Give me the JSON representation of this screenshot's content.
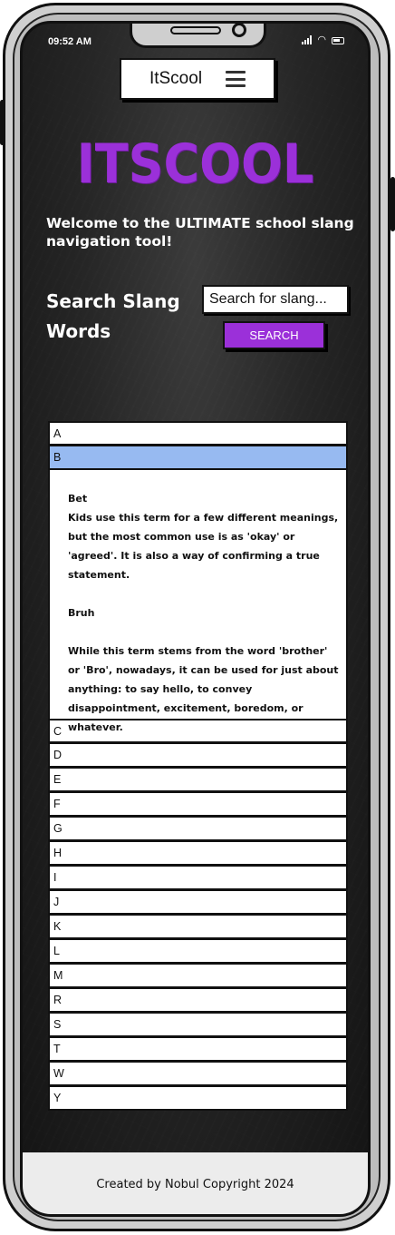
{
  "status": {
    "time": "09:52 AM",
    "icons": [
      "signal-icon",
      "wifi-icon",
      "battery-icon"
    ]
  },
  "nav": {
    "title": "ItScool",
    "menu_icon": "hamburger-menu-icon"
  },
  "hero": {
    "logo_text": "ITSCOOL",
    "welcome": "Welcome to the ULTIMATE school slang navigation tool!"
  },
  "search": {
    "heading": "Search Slang Words",
    "placeholder": "Search for slang...",
    "button_label": "SEARCH"
  },
  "accordion": {
    "before": [
      "A"
    ],
    "active": "B",
    "entries": [
      {
        "term": "Bet",
        "definition": "Kids use this term for a few different meanings, but the most common use is as 'okay' or 'agreed'. It is also a way of confirming a true statement."
      },
      {
        "term": "Bruh",
        "definition": "While this term stems from the word 'brother' or 'Bro', nowadays, it can be used for just about anything: to say hello, to convey disappointment, excitement, boredom, or whatever."
      }
    ],
    "after": [
      "C",
      "D",
      "E",
      "F",
      "G",
      "H",
      "I",
      "J",
      "K",
      "L",
      "M",
      "R",
      "S",
      "T",
      "W",
      "Y"
    ]
  },
  "footer": {
    "text": "Created by Nobul Copyright 2024"
  },
  "colors": {
    "accent": "#9b30d9",
    "active_row": "#97baf1",
    "background": "#262626"
  }
}
